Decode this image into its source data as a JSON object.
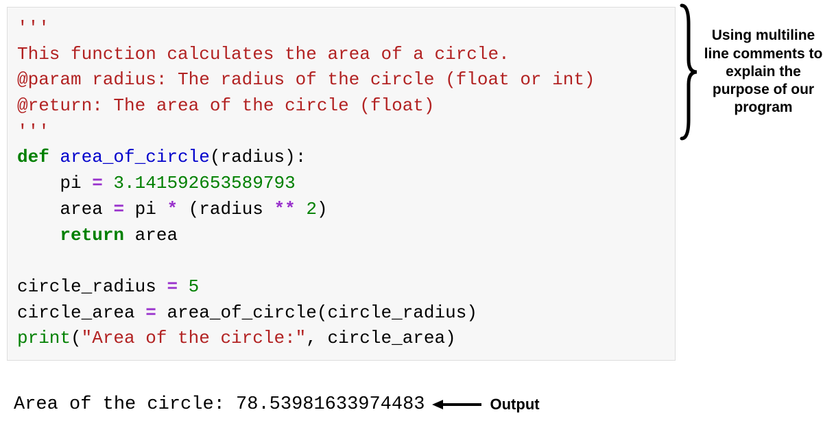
{
  "code": {
    "docstring_open": "'''",
    "doc1": "This function calculates the area of a circle.",
    "doc2": "@param radius: The radius of the circle (float or int)",
    "doc3": "@return: The area of the circle (float)",
    "docstring_close": "'''",
    "def_kw": "def",
    "funcname": "area_of_circle",
    "lparen": "(",
    "param": "radius",
    "rparen_colon": "):",
    "pi_ident": "    pi ",
    "eq1": "=",
    "pi_val": " 3.141592653589793",
    "area_ident": "    area ",
    "eq2": "=",
    "pi_ref": " pi ",
    "star": "*",
    "lpar2": " (radius ",
    "dblstar": "**",
    "two": " 2",
    "rpar2": ")",
    "return_kw": "    return",
    "return_val": " area",
    "assign1": "circle_radius ",
    "eq3": "=",
    "five": " 5",
    "assign2_lhs": "circle_area ",
    "eq4": "=",
    "call_fn": " area_of_circle(circle_radius)",
    "print_kw": "print",
    "print_lpar": "(",
    "print_str": "\"Area of the circle:\"",
    "print_rest": ", circle_area)"
  },
  "annotation_right": "Using multiline line comments to explain the purpose of our program",
  "output_text": "Area of the circle: 78.53981633974483",
  "output_label": "Output"
}
